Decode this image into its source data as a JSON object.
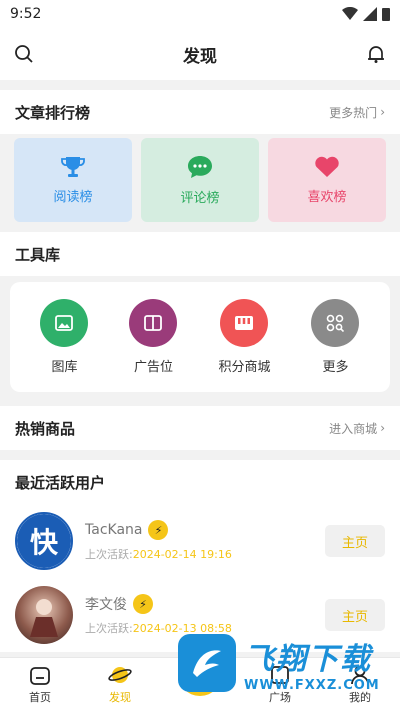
{
  "status_bar": {
    "time": "9:52"
  },
  "header": {
    "title": "发现"
  },
  "ranking": {
    "title": "文章排行榜",
    "more": "更多热门",
    "cards": [
      {
        "label": "阅读榜",
        "icon": "trophy-icon",
        "bg": "#d6e6f7",
        "color": "#2a8ee6"
      },
      {
        "label": "评论榜",
        "icon": "comment-icon",
        "bg": "#d5ede0",
        "color": "#2aaa5c"
      },
      {
        "label": "喜欢榜",
        "icon": "heart-icon",
        "bg": "#f7d9e1",
        "color": "#e8456a"
      }
    ]
  },
  "tools": {
    "title": "工具库",
    "items": [
      {
        "label": "图库",
        "icon": "image-icon",
        "color": "#2fb06a"
      },
      {
        "label": "广告位",
        "icon": "book-icon",
        "color": "#9a3b7a"
      },
      {
        "label": "积分商城",
        "icon": "shop-icon",
        "color": "#f05455"
      },
      {
        "label": "更多",
        "icon": "grid-icon",
        "color": "#8a8a8a"
      }
    ]
  },
  "products": {
    "title": "热销商品",
    "more": "进入商城"
  },
  "users": {
    "title": "最近活跃用户",
    "last_active_label": "上次活跃:",
    "button_label": "主页",
    "list": [
      {
        "name": "TacKana",
        "last_active": "2024-02-14 19:16",
        "avatar_text": "快"
      },
      {
        "name": "李文俊",
        "last_active": "2024-02-13 08:58",
        "avatar_text": ""
      }
    ]
  },
  "tab_bar": {
    "items": [
      {
        "label": "首页",
        "icon": "home-icon"
      },
      {
        "label": "发现",
        "icon": "planet-icon"
      },
      {
        "label": "广场",
        "icon": "square-icon"
      },
      {
        "label": "我的",
        "icon": "user-icon"
      }
    ]
  },
  "watermark": {
    "big": "飞翔下载",
    "small": "WWW.FXXZ.COM"
  }
}
